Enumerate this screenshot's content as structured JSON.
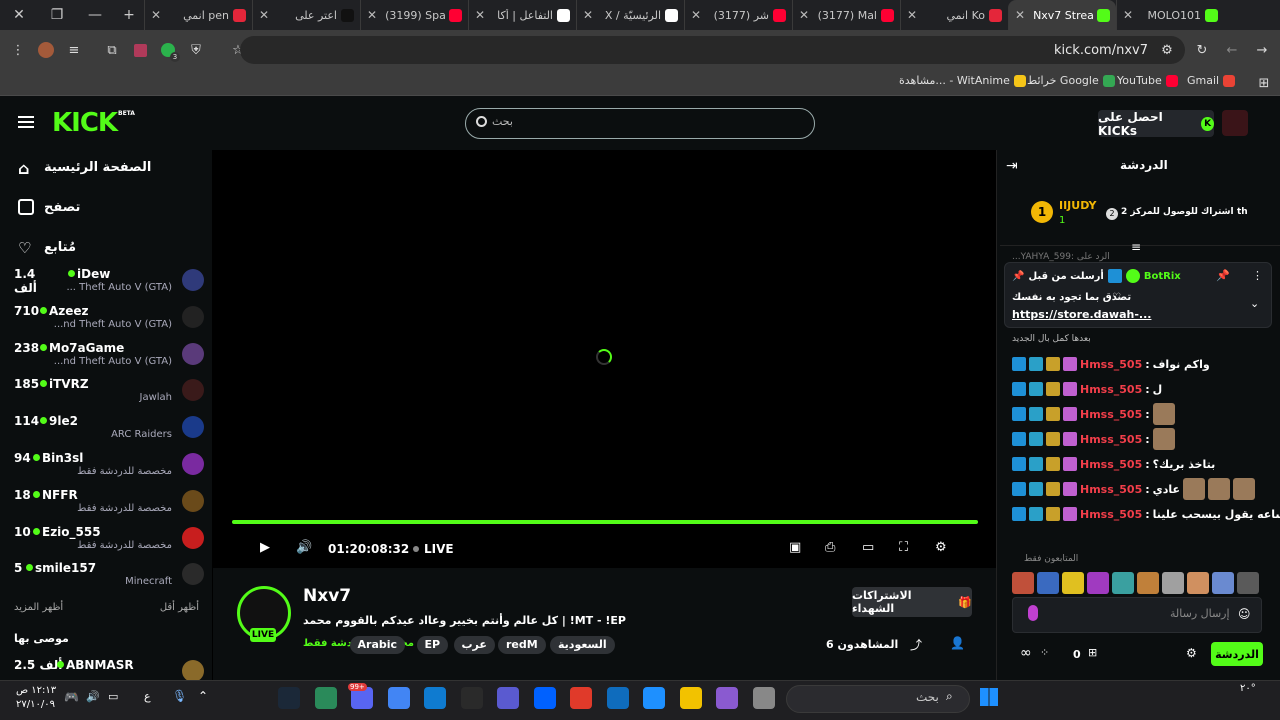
{
  "tabs": [
    {
      "label": "MOLO101",
      "color": "#53fc18"
    },
    {
      "label": "Nxv7 Strea",
      "color": "#53fc18",
      "active": true
    },
    {
      "label": "انمي Ko",
      "color": "#e4263a"
    },
    {
      "label": "(3177) Mal",
      "color": "#ff0033"
    },
    {
      "label": "(3177) شر",
      "color": "#ff0033"
    },
    {
      "label": "X / الرئيسيّة",
      "color": "#ffffff"
    },
    {
      "label": "التفاعل | أكا",
      "color": "#ffffff"
    },
    {
      "label": "(3199) Spa",
      "color": "#ff0033"
    },
    {
      "label": "اعتر على",
      "color": "#111111"
    },
    {
      "label": "انمي pen",
      "color": "#e4263a"
    }
  ],
  "address": {
    "url": "kick.com/nxv7"
  },
  "extension_badge": "3",
  "bookmarks": [
    {
      "label": "Gmail",
      "color": "#ea4335"
    },
    {
      "label": "YouTube",
      "color": "#ff0033"
    },
    {
      "label": "خرائط Google",
      "color": "#34a853"
    },
    {
      "label": "مشاهدة... - WitAnime",
      "color": "#f5c518"
    }
  ],
  "header": {
    "logo": "KICK",
    "beta": "BETA",
    "search_placeholder": "بحث",
    "kicks_label": "احصل على KICKs"
  },
  "sidebar": {
    "nav": [
      {
        "label": "الصفحة الرئيسية",
        "icon": "home-icon"
      },
      {
        "label": "تصفح",
        "icon": "browse-icon"
      },
      {
        "label": "مُتابع",
        "icon": "heart-icon"
      }
    ],
    "channels": [
      {
        "viewers": "1.4 ألف",
        "name": "iDew",
        "category": "... Theft Auto V (GTA)",
        "color": "#2f3a7a"
      },
      {
        "viewers": "710",
        "name": "Azeez",
        "category": "...nd Theft Auto V (GTA)",
        "color": "#222222"
      },
      {
        "viewers": "238",
        "name": "Mo7aGame",
        "category": "...nd Theft Auto V (GTA)",
        "color": "#5a3a7a"
      },
      {
        "viewers": "185",
        "name": "iTVRZ",
        "category": "Jawlah",
        "color": "#3a1a1a"
      },
      {
        "viewers": "114",
        "name": "9le2",
        "category": "ARC Raiders",
        "color": "#1a3a8a"
      },
      {
        "viewers": "94",
        "name": "Bin3sl",
        "category": "مخصصة للدردشة فقط",
        "color": "#7a2aa0"
      },
      {
        "viewers": "18",
        "name": "NFFR",
        "category": "مخصصة للدردشة فقط",
        "color": "#6a4a1a"
      },
      {
        "viewers": "10",
        "name": "Ezio_555",
        "category": "مخصصة للدردشة فقط",
        "color": "#c81e1e"
      },
      {
        "viewers": "5",
        "name": "smile157",
        "category": "Minecraft",
        "color": "#2a2a2a"
      }
    ],
    "show_more": "أظهر المزيد",
    "show_less": "أظهر أقل",
    "recommended": "موصى بها",
    "rec_channel": {
      "viewers": "2.5 ألف",
      "name": "ABNMASR"
    }
  },
  "player": {
    "time": "01:20:08:32",
    "live": "LIVE",
    "progress": 1.0
  },
  "stream": {
    "name": "Nxv7",
    "title": "كل عالم وأنتم بخيير وعااد عيدكم بالقووم محمد | !MT - !EP",
    "category": "مخصصة للدردشة فقط",
    "live_badge": "LIVE",
    "tags": [
      "السعودية",
      "redM",
      "عرب",
      "EP",
      "Arabic"
    ],
    "viewers_label": "6 المشاهدون",
    "subs_button": "الاشتراكات الشهداء"
  },
  "chat": {
    "title": "الدردشة",
    "top_gifter": {
      "name": "IIJUDY",
      "rank": "1",
      "count": "1",
      "note": "إهداء 1 اشتراك للوصول للمركز 2",
      "rank2": "2",
      "suffix": "th"
    },
    "hidden_line": "...YAHYA_599: الرد على",
    "pinned": {
      "prefix": "أرسلت من قبل",
      "user": "BotRix",
      "text": "تصدق بما تجود به نفسك",
      "link": "https://store.dawah-..."
    },
    "intro_line": "بعدها كمل بال الجديد",
    "messages": [
      {
        "user": "Hmss_505",
        "text": "واكم نواف"
      },
      {
        "user": "Hmss_505",
        "text": "ل"
      },
      {
        "user": "Hmss_505",
        "text": ""
      },
      {
        "user": "Hmss_505",
        "text": ""
      },
      {
        "user": "Hmss_505",
        "text": "بتاخذ بريك؟"
      },
      {
        "user": "Hmss_505",
        "text": "عادي"
      },
      {
        "user": "Hmss_505",
        "text": "له ساعه يقول بيسحب علينا"
      }
    ],
    "followers_only": "المتابعون فقط",
    "input_placeholder": "إرسال رسالة",
    "send_label": "الدردشة",
    "points": "0"
  },
  "taskbar": {
    "time": "١٢:١٣ ص",
    "date": "٢٧/١٠/٠٩",
    "lang": "ع",
    "search": "بحث",
    "discord_badge": "99+",
    "temperature": "٢٠°"
  }
}
